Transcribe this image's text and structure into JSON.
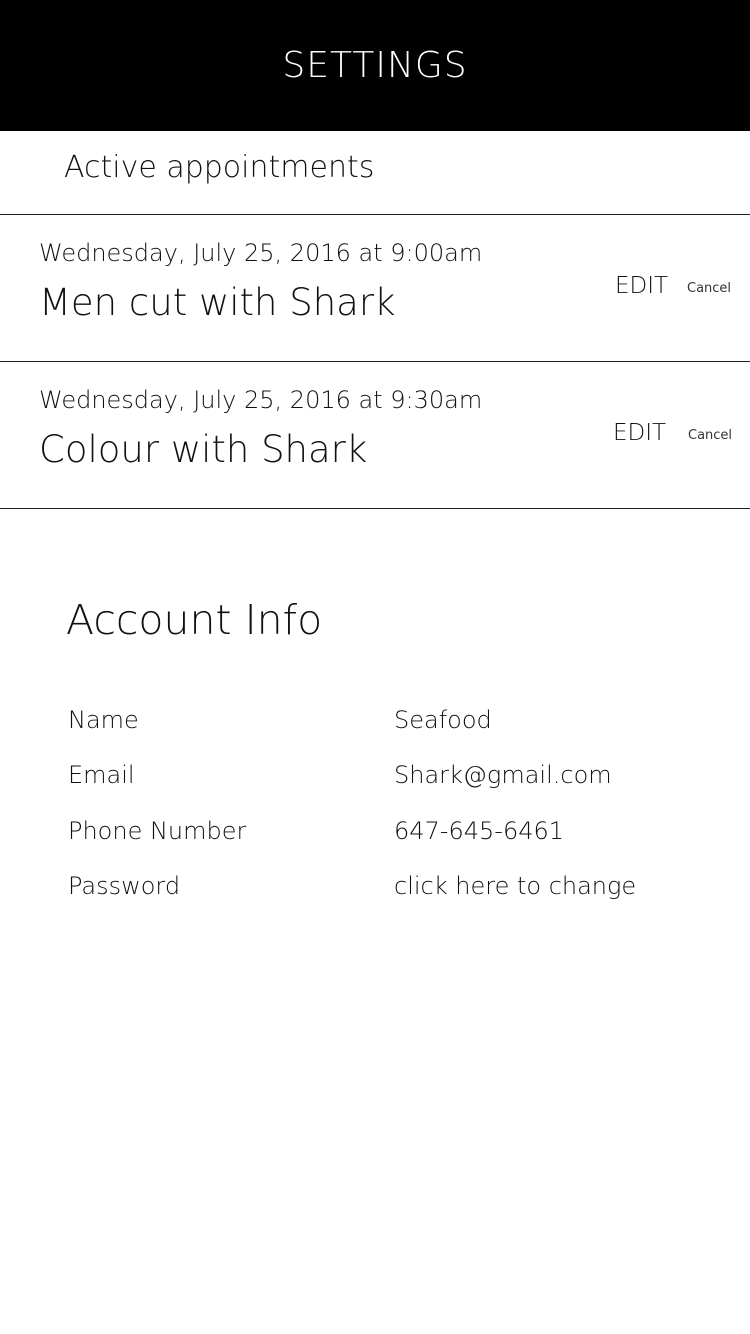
{
  "header": {
    "title": "SETTINGS"
  },
  "appointments_section": {
    "label": "Active appointments",
    "items": [
      {
        "date": "Wednesday, July 25, 2016 at 9:00am",
        "service": "Men cut with Shark",
        "edit_label": "EDIT",
        "cancel_label": "Cancel"
      },
      {
        "date": "Wednesday, July 25, 2016 at 9:30am",
        "service": "Colour with Shark",
        "edit_label": "EDIT",
        "cancel_label": "Cancel"
      }
    ]
  },
  "account": {
    "title": "Account Info",
    "fields": [
      {
        "label": "Name",
        "value": "Seafood"
      },
      {
        "label": "Email",
        "value": "Shark@gmail.com"
      },
      {
        "label": "Phone Number",
        "value": "647-645-6461"
      },
      {
        "label": "Password",
        "value": "click here to change"
      }
    ]
  },
  "colors": {
    "header_bg": "#000000",
    "header_text": "#ffffff",
    "divider": "#222222",
    "text": "#111111"
  }
}
